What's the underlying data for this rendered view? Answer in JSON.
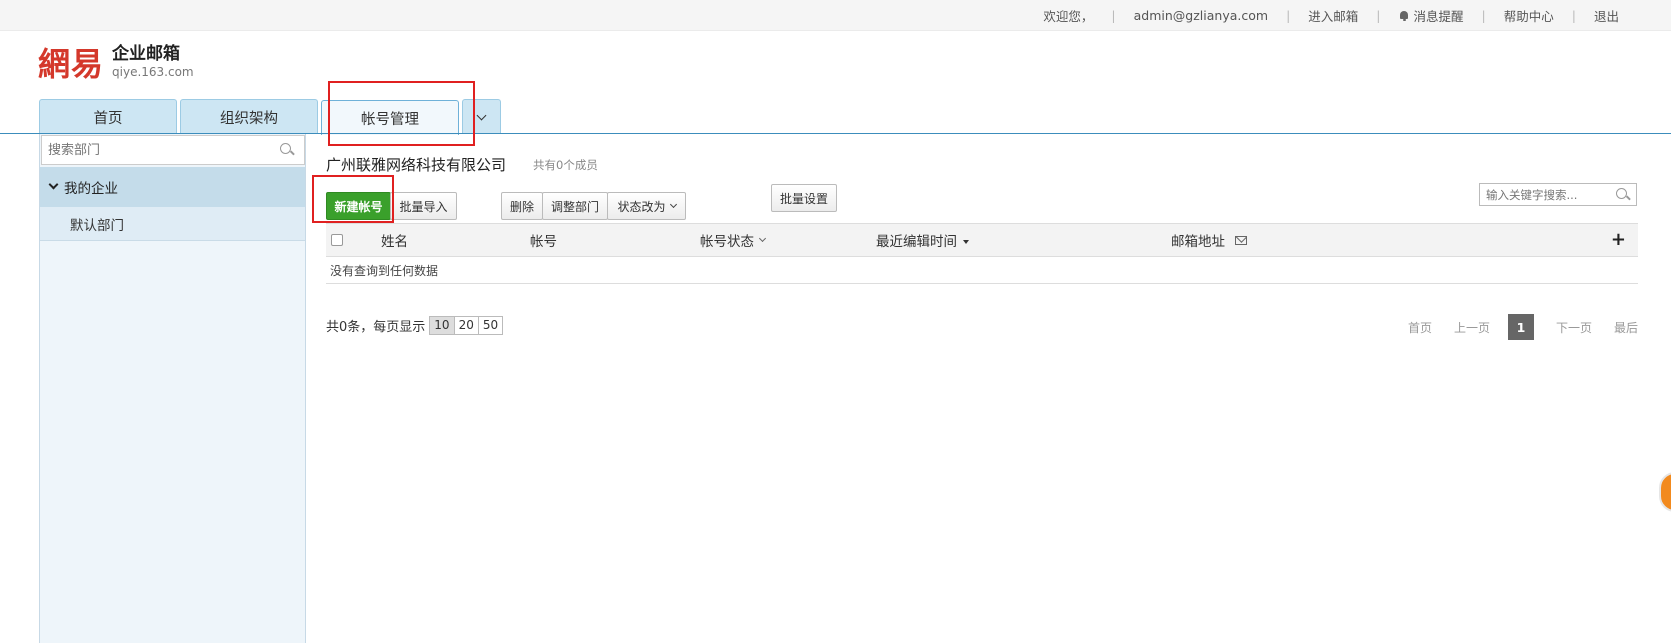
{
  "topbar": {
    "welcome": "欢迎您，",
    "user": "admin@gzlianya.com",
    "enter_mailbox": "进入邮箱",
    "notifications": "消息提醒",
    "help": "帮助中心",
    "logout": "退出"
  },
  "logo": {
    "mark": "網易",
    "name": "企业邮箱",
    "domain": "qiye.163.com"
  },
  "tabs": [
    {
      "label": "首页"
    },
    {
      "label": "组织架构"
    },
    {
      "label": "帐号管理"
    }
  ],
  "sidebar": {
    "search_placeholder": "搜索部门",
    "root": "我的企业",
    "child": "默认部门"
  },
  "main": {
    "title": "广州联雅网络科技有限公司",
    "member_count": "共有0个成员",
    "buttons": {
      "new_account": "新建帐号",
      "batch_import": "批量导入",
      "delete": "删除",
      "adjust_dept": "调整部门",
      "change_status": "状态改为",
      "batch_settings": "批量设置"
    },
    "keyword_placeholder": "输入关键字搜索...",
    "columns": [
      "姓名",
      "帐号",
      "帐号状态",
      "最近编辑时间",
      "邮箱地址"
    ],
    "empty_text": "没有查询到任何数据"
  },
  "pager": {
    "summary": "共0条，每页显示",
    "page_sizes": [
      "10",
      "20",
      "50"
    ],
    "selected_page_size": "10",
    "first": "首页",
    "prev": "上一页",
    "current": "1",
    "next": "下一页",
    "last": "最后"
  },
  "colors": {
    "primary_button": "#3aa02b",
    "tab_bg": "#cde6f3",
    "tab_active_bg": "#f2f8fc",
    "highlight_box": "#e02020",
    "logo_red": "#d4382b"
  },
  "icons": [
    "bell-icon",
    "search-icon",
    "chevron-down-icon",
    "sort-desc-icon",
    "mail-icon",
    "plus-icon"
  ]
}
